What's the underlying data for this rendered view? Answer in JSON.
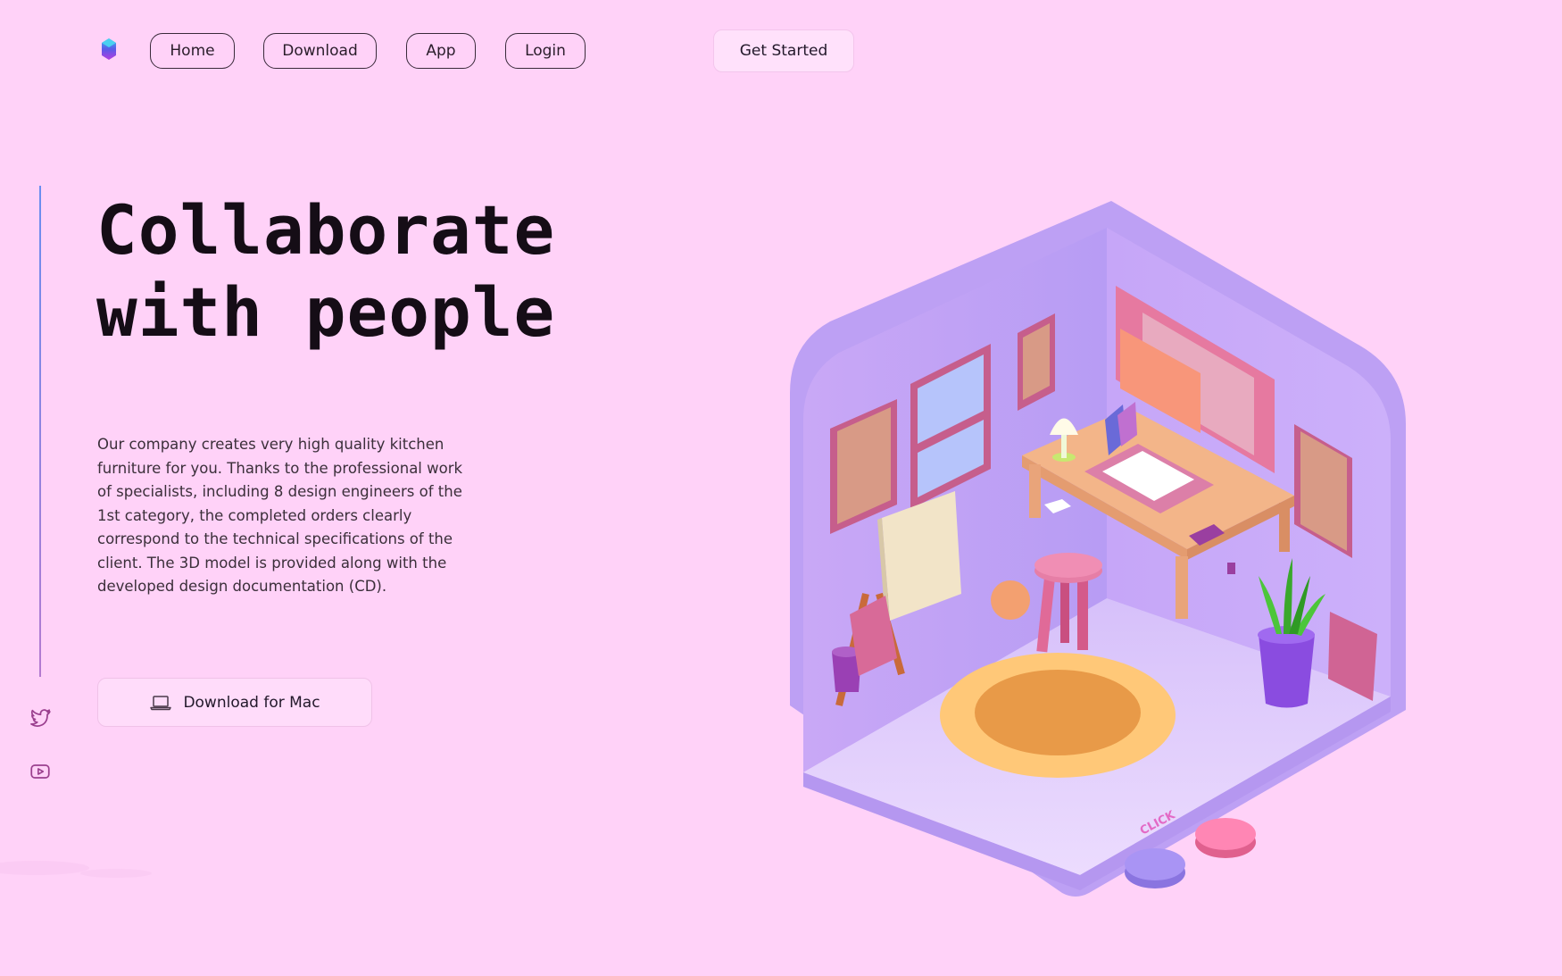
{
  "nav": {
    "items": [
      "Home",
      "Download",
      "App",
      "Login"
    ],
    "cta": "Get Started"
  },
  "hero": {
    "title_line1": "Collaborate",
    "title_line2": "with people",
    "description": "Our company creates very high quality kitchen furniture for you. Thanks to the professional work of specialists, including 8 design engineers of the 1st category, the completed orders clearly correspond to the technical specifications of the client. The 3D model is provided along with the developed design documentation (CD).",
    "download_button": "Download for Mac"
  },
  "social": {
    "icons": [
      "twitter-icon",
      "youtube-icon"
    ]
  },
  "illustration": {
    "floor_label": "CLICK"
  },
  "colors": {
    "background": "#ffd2f8",
    "room_wall": "#c8aaf8",
    "room_floor": "#e6d2fc",
    "rug_outer": "#ffc878",
    "rug_inner": "#e89a48",
    "accent_pink": "#e8789e",
    "accent_purple": "#a08ef0"
  }
}
